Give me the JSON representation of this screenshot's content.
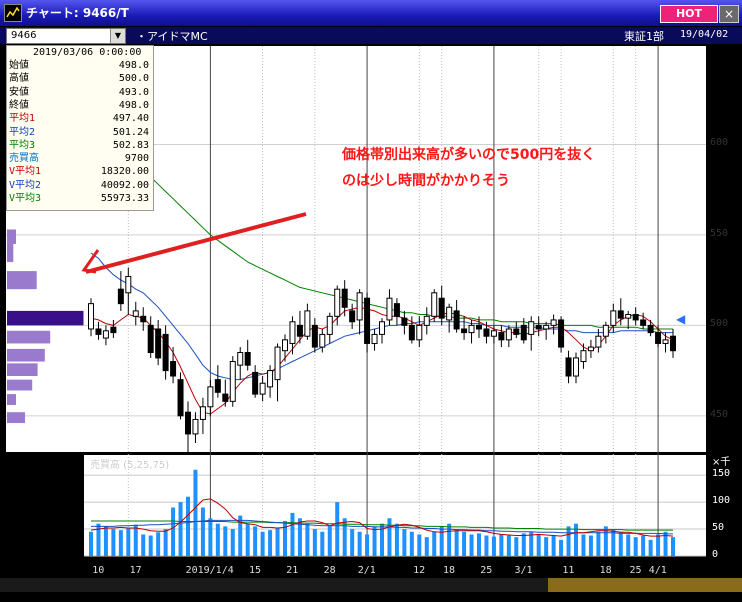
{
  "window": {
    "title": "チャート: 9466/T",
    "hot_label": "HOT",
    "close_label": "×"
  },
  "toolbar": {
    "symbol": "9466",
    "company": "・アイドマMC",
    "market": "東証1部",
    "date": "19/04/02"
  },
  "info_panel": {
    "datetime": "2019/03/06 0:00:00",
    "rows": [
      {
        "label": "始値",
        "value": "498.0",
        "color": "#000000"
      },
      {
        "label": "高値",
        "value": "500.0",
        "color": "#000000"
      },
      {
        "label": "安値",
        "value": "493.0",
        "color": "#000000"
      },
      {
        "label": "終値",
        "value": "498.0",
        "color": "#000000"
      },
      {
        "label": "平均1",
        "value": "497.40",
        "color": "#c00000"
      },
      {
        "label": "平均2",
        "value": "501.24",
        "color": "#1040c0"
      },
      {
        "label": "平均3",
        "value": "502.83",
        "color": "#008000"
      },
      {
        "label": "売買高",
        "value": "9700",
        "color": "#0070c0"
      },
      {
        "label": "V平均1",
        "value": "18320.00",
        "color": "#c00000"
      },
      {
        "label": "V平均2",
        "value": "40092.00",
        "color": "#1040c0"
      },
      {
        "label": "V平均3",
        "value": "55973.33",
        "color": "#008000"
      }
    ]
  },
  "annotation": {
    "line1": "価格帯別出来高が多いので500円を抜く",
    "line2": "のは少し時間がかかりそう",
    "color": "#ff1616"
  },
  "volume_panel": {
    "label": "売買高 (5,25,75)",
    "unit": "×千"
  },
  "chart_data": {
    "type": "candlestick",
    "y_ticks": [
      "600",
      "550",
      "500",
      "450"
    ],
    "ylim": [
      430,
      650
    ],
    "volume_ticks": [
      "150",
      "100",
      "50",
      "0"
    ],
    "volume_ylim": [
      0,
      180
    ],
    "x_tick_labels": [
      "10",
      "17",
      "2019/1/4",
      "15",
      "21",
      "28",
      "2/1",
      "12",
      "18",
      "25",
      "3/1",
      "11",
      "18",
      "25",
      "4/1"
    ],
    "candles": [
      {
        "o": 498,
        "h": 515,
        "l": 494,
        "c": 512
      },
      {
        "o": 498,
        "h": 502,
        "l": 492,
        "c": 495
      },
      {
        "o": 493,
        "h": 500,
        "l": 489,
        "c": 497
      },
      {
        "o": 499,
        "h": 503,
        "l": 493,
        "c": 496
      },
      {
        "o": 520,
        "h": 530,
        "l": 508,
        "c": 512
      },
      {
        "o": 518,
        "h": 532,
        "l": 506,
        "c": 527
      },
      {
        "o": 505,
        "h": 513,
        "l": 500,
        "c": 508
      },
      {
        "o": 505,
        "h": 510,
        "l": 497,
        "c": 502
      },
      {
        "o": 500,
        "h": 505,
        "l": 482,
        "c": 485
      },
      {
        "o": 498,
        "h": 503,
        "l": 478,
        "c": 482
      },
      {
        "o": 495,
        "h": 500,
        "l": 470,
        "c": 475
      },
      {
        "o": 480,
        "h": 488,
        "l": 468,
        "c": 472
      },
      {
        "o": 470,
        "h": 474,
        "l": 448,
        "c": 450
      },
      {
        "o": 452,
        "h": 458,
        "l": 430,
        "c": 440
      },
      {
        "o": 440,
        "h": 452,
        "l": 435,
        "c": 448
      },
      {
        "o": 448,
        "h": 460,
        "l": 440,
        "c": 455
      },
      {
        "o": 455,
        "h": 470,
        "l": 450,
        "c": 466
      },
      {
        "o": 470,
        "h": 478,
        "l": 460,
        "c": 463
      },
      {
        "o": 462,
        "h": 470,
        "l": 455,
        "c": 458
      },
      {
        "o": 458,
        "h": 483,
        "l": 455,
        "c": 480
      },
      {
        "o": 478,
        "h": 488,
        "l": 470,
        "c": 485
      },
      {
        "o": 485,
        "h": 492,
        "l": 475,
        "c": 478
      },
      {
        "o": 474,
        "h": 478,
        "l": 460,
        "c": 462
      },
      {
        "o": 462,
        "h": 472,
        "l": 458,
        "c": 468
      },
      {
        "o": 466,
        "h": 478,
        "l": 460,
        "c": 475
      },
      {
        "o": 470,
        "h": 490,
        "l": 458,
        "c": 488
      },
      {
        "o": 486,
        "h": 495,
        "l": 480,
        "c": 492
      },
      {
        "o": 490,
        "h": 505,
        "l": 484,
        "c": 502
      },
      {
        "o": 500,
        "h": 508,
        "l": 490,
        "c": 494
      },
      {
        "o": 494,
        "h": 512,
        "l": 492,
        "c": 508
      },
      {
        "o": 500,
        "h": 504,
        "l": 485,
        "c": 488
      },
      {
        "o": 488,
        "h": 498,
        "l": 485,
        "c": 495
      },
      {
        "o": 495,
        "h": 507,
        "l": 490,
        "c": 505
      },
      {
        "o": 505,
        "h": 522,
        "l": 500,
        "c": 520
      },
      {
        "o": 520,
        "h": 525,
        "l": 505,
        "c": 510
      },
      {
        "o": 508,
        "h": 512,
        "l": 498,
        "c": 502
      },
      {
        "o": 503,
        "h": 520,
        "l": 495,
        "c": 518
      },
      {
        "o": 515,
        "h": 518,
        "l": 485,
        "c": 490
      },
      {
        "o": 490,
        "h": 498,
        "l": 486,
        "c": 495
      },
      {
        "o": 495,
        "h": 504,
        "l": 490,
        "c": 502
      },
      {
        "o": 503,
        "h": 520,
        "l": 500,
        "c": 515
      },
      {
        "o": 512,
        "h": 515,
        "l": 500,
        "c": 505
      },
      {
        "o": 504,
        "h": 508,
        "l": 495,
        "c": 500
      },
      {
        "o": 500,
        "h": 505,
        "l": 490,
        "c": 492
      },
      {
        "o": 492,
        "h": 505,
        "l": 488,
        "c": 500
      },
      {
        "o": 500,
        "h": 510,
        "l": 495,
        "c": 505
      },
      {
        "o": 505,
        "h": 520,
        "l": 502,
        "c": 518
      },
      {
        "o": 515,
        "h": 522,
        "l": 500,
        "c": 504
      },
      {
        "o": 503,
        "h": 512,
        "l": 496,
        "c": 510
      },
      {
        "o": 508,
        "h": 514,
        "l": 496,
        "c": 498
      },
      {
        "o": 498,
        "h": 505,
        "l": 492,
        "c": 496
      },
      {
        "o": 496,
        "h": 503,
        "l": 490,
        "c": 500
      },
      {
        "o": 500,
        "h": 505,
        "l": 493,
        "c": 498
      },
      {
        "o": 498,
        "h": 502,
        "l": 490,
        "c": 494
      },
      {
        "o": 494,
        "h": 500,
        "l": 490,
        "c": 497
      },
      {
        "o": 496,
        "h": 500,
        "l": 488,
        "c": 492
      },
      {
        "o": 492,
        "h": 500,
        "l": 488,
        "c": 498
      },
      {
        "o": 498,
        "h": 502,
        "l": 493,
        "c": 495
      },
      {
        "o": 500,
        "h": 504,
        "l": 490,
        "c": 492
      },
      {
        "o": 495,
        "h": 505,
        "l": 486,
        "c": 502
      },
      {
        "o": 500,
        "h": 505,
        "l": 494,
        "c": 498
      },
      {
        "o": 498,
        "h": 502,
        "l": 492,
        "c": 500
      },
      {
        "o": 500,
        "h": 506,
        "l": 495,
        "c": 503
      },
      {
        "o": 503,
        "h": 505,
        "l": 485,
        "c": 488
      },
      {
        "o": 482,
        "h": 486,
        "l": 468,
        "c": 472
      },
      {
        "o": 472,
        "h": 485,
        "l": 468,
        "c": 482
      },
      {
        "o": 480,
        "h": 490,
        "l": 476,
        "c": 486
      },
      {
        "o": 486,
        "h": 492,
        "l": 482,
        "c": 488
      },
      {
        "o": 488,
        "h": 498,
        "l": 485,
        "c": 494
      },
      {
        "o": 494,
        "h": 502,
        "l": 490,
        "c": 500
      },
      {
        "o": 500,
        "h": 512,
        "l": 496,
        "c": 508
      },
      {
        "o": 508,
        "h": 515,
        "l": 500,
        "c": 504
      },
      {
        "o": 504,
        "h": 508,
        "l": 498,
        "c": 506
      },
      {
        "o": 506,
        "h": 510,
        "l": 500,
        "c": 503
      },
      {
        "o": 503,
        "h": 507,
        "l": 498,
        "c": 500
      },
      {
        "o": 500,
        "h": 503,
        "l": 494,
        "c": 496
      },
      {
        "o": 496,
        "h": 500,
        "l": 488,
        "c": 490
      },
      {
        "o": 490,
        "h": 496,
        "l": 485,
        "c": 492
      },
      {
        "o": 494,
        "h": 498,
        "l": 482,
        "c": 486
      }
    ],
    "ma5": [
      504,
      503,
      501,
      500,
      503,
      506,
      505,
      504,
      500,
      496,
      491,
      485,
      477,
      468,
      459,
      452,
      451,
      454,
      457,
      463,
      468,
      472,
      474,
      473,
      474,
      477,
      482,
      487,
      492,
      497,
      499,
      498,
      500,
      504,
      508,
      509,
      510,
      509,
      508,
      506,
      505,
      505,
      504,
      502,
      500,
      502,
      504,
      506,
      507,
      506,
      505,
      503,
      502,
      500,
      498,
      497,
      496,
      496,
      495,
      496,
      497,
      498,
      499,
      499,
      496,
      492,
      488,
      486,
      489,
      494,
      500,
      503,
      505,
      506,
      505,
      502,
      498,
      494,
      492
    ],
    "ma25": [
      540,
      537,
      532,
      528,
      525,
      523,
      520,
      518,
      514,
      510,
      505,
      500,
      495,
      490,
      484,
      478,
      474,
      472,
      471,
      470,
      470,
      471,
      472,
      473,
      474,
      476,
      478,
      480,
      482,
      484,
      486,
      488,
      490,
      492,
      494,
      495,
      496,
      497,
      498,
      499,
      500,
      500,
      501,
      501,
      502,
      502,
      502,
      502,
      502,
      502,
      502,
      501,
      501,
      500,
      500,
      500,
      499,
      499,
      499,
      499,
      499,
      498,
      498,
      498,
      497,
      497,
      496,
      496,
      496,
      496,
      496,
      497,
      497,
      497,
      497,
      497,
      496,
      496,
      496
    ],
    "ma75": [
      615,
      610,
      606,
      602,
      598,
      594,
      590,
      586,
      582,
      578,
      574,
      570,
      566,
      562,
      558,
      554,
      550,
      547,
      544,
      541,
      538,
      535,
      533,
      531,
      529,
      527,
      525,
      523,
      521,
      520,
      519,
      518,
      517,
      516,
      515,
      514,
      513,
      512,
      511,
      510,
      509,
      508,
      507,
      507,
      506,
      506,
      505,
      505,
      505,
      504,
      504,
      504,
      503,
      503,
      503,
      502,
      502,
      502,
      502,
      501,
      501,
      501,
      501,
      500,
      500,
      500,
      500,
      500,
      499,
      499,
      499,
      499,
      499,
      499,
      498,
      498,
      498,
      498,
      498
    ],
    "volumes": [
      45,
      60,
      55,
      50,
      48,
      52,
      58,
      40,
      38,
      44,
      50,
      90,
      100,
      110,
      160,
      90,
      70,
      60,
      55,
      50,
      75,
      60,
      55,
      45,
      48,
      52,
      65,
      80,
      70,
      60,
      50,
      45,
      55,
      100,
      70,
      50,
      45,
      40,
      55,
      60,
      70,
      60,
      50,
      45,
      40,
      35,
      45,
      55,
      60,
      50,
      45,
      40,
      42,
      38,
      36,
      40,
      38,
      35,
      42,
      45,
      40,
      35,
      38,
      30,
      55,
      60,
      40,
      38,
      45,
      55,
      50,
      45,
      40,
      35,
      38,
      30,
      40,
      45,
      35
    ],
    "vol_ma5": [
      48,
      50,
      52,
      52,
      53,
      52,
      52,
      50,
      47,
      46,
      46,
      52,
      63,
      76,
      90,
      104,
      106,
      98,
      87,
      71,
      62,
      60,
      58,
      53,
      53,
      52,
      53,
      58,
      63,
      65,
      65,
      62,
      56,
      61,
      63,
      64,
      62,
      51,
      49,
      50,
      54,
      57,
      59,
      57,
      53,
      48,
      45,
      44,
      46,
      47,
      47,
      47,
      47,
      45,
      42,
      40,
      39,
      38,
      38,
      39,
      40,
      39,
      38,
      37,
      40,
      43,
      43,
      45,
      47,
      47,
      46,
      44,
      44,
      42,
      39,
      37,
      37,
      38,
      37
    ],
    "vol_ma25": [
      55,
      55,
      55,
      55,
      56,
      56,
      57,
      57,
      58,
      58,
      59,
      60,
      61,
      62,
      64,
      65,
      66,
      66,
      66,
      66,
      66,
      66,
      65,
      64,
      63,
      62,
      61,
      60,
      59,
      58,
      57,
      56,
      56,
      56,
      56,
      55,
      55,
      55,
      54,
      54,
      54,
      53,
      53,
      52,
      52,
      51,
      51,
      50,
      50,
      49,
      49,
      48,
      48,
      47,
      47,
      46,
      46,
      45,
      45,
      45,
      44,
      44,
      44,
      43,
      43,
      43,
      43,
      43,
      43,
      43,
      43,
      42,
      42,
      42,
      42,
      42,
      42,
      41,
      41
    ],
    "vol_ma75": [
      65,
      65,
      65,
      65,
      65,
      65,
      65,
      65,
      65,
      65,
      65,
      65,
      64,
      64,
      64,
      64,
      64,
      64,
      64,
      63,
      63,
      63,
      63,
      63,
      62,
      62,
      62,
      62,
      61,
      61,
      61,
      60,
      60,
      60,
      59,
      59,
      59,
      58,
      58,
      58,
      57,
      57,
      56,
      56,
      56,
      55,
      55,
      55,
      54,
      54,
      54,
      53,
      53,
      53,
      52,
      52,
      52,
      51,
      51,
      51,
      51,
      50,
      50,
      50,
      50,
      50,
      49,
      49,
      49,
      49,
      49,
      49,
      48,
      48,
      48,
      48,
      48,
      48,
      48
    ],
    "volume_profile": [
      {
        "price_from": 545,
        "price_to": 553,
        "value": 0.1
      },
      {
        "price_from": 535,
        "price_to": 545,
        "value": 0.07
      },
      {
        "price_from": 520,
        "price_to": 530,
        "value": 0.33
      },
      {
        "price_from": 500,
        "price_to": 508,
        "value": 0.85
      },
      {
        "price_from": 490,
        "price_to": 497,
        "value": 0.48
      },
      {
        "price_from": 480,
        "price_to": 487,
        "value": 0.42
      },
      {
        "price_from": 472,
        "price_to": 479,
        "value": 0.34
      },
      {
        "price_from": 464,
        "price_to": 470,
        "value": 0.28
      },
      {
        "price_from": 456,
        "price_to": 462,
        "value": 0.1
      },
      {
        "price_from": 446,
        "price_to": 452,
        "value": 0.2
      }
    ],
    "colors": {
      "up": "#ffffff",
      "down": "#000000",
      "ma5": "#c00000",
      "ma25": "#1a50c0",
      "ma75": "#008000",
      "volume_bar": "#1e90ff",
      "profile": "#9a7acc",
      "profile_highlight": "#3a0f8a"
    }
  }
}
